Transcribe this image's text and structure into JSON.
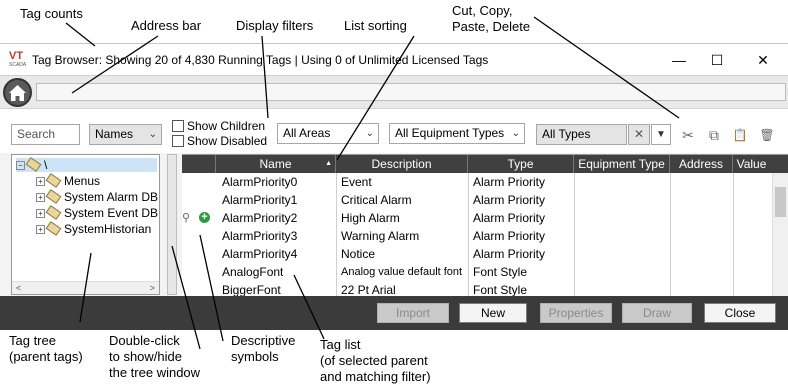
{
  "callouts": {
    "tag_counts": "Tag counts",
    "address_bar": "Address bar",
    "display_filters": "Display filters",
    "list_sorting": "List sorting",
    "cut_copy": "Cut, Copy,\nPaste, Delete",
    "tag_tree": "Tag tree\n(parent tags)",
    "double_click": "Double-click\nto show/hide\nthe tree window",
    "descriptive_symbols": "Descriptive\nsymbols",
    "tag_list": "Tag list\n(of selected parent\nand matching filter)"
  },
  "window": {
    "logo_text": "VT",
    "logo_sub": "SCADA",
    "title": "Tag Browser: Showing 20 of 4,830 Running Tags | Using 0 of Unlimited Licensed Tags",
    "minimize_glyph": "—",
    "maximize_glyph": "☐",
    "close_glyph": "✕"
  },
  "toolbar": {
    "search_placeholder": "Search",
    "search_value": "",
    "names_select": "Names",
    "show_children": "Show Children",
    "show_disabled": "Show Disabled",
    "areas_select": "All Areas",
    "equipment_select": "All Equipment Types",
    "types_select": "All Types",
    "clear_glyph": "✕",
    "filter_glyph": "▼",
    "cut_glyph": "✂",
    "copy_glyph": "⧉",
    "paste_glyph": "📋",
    "delete_glyph": "🗑"
  },
  "tree": {
    "root": "\\",
    "items": [
      "Menus",
      "System Alarm DB",
      "System Event DB",
      "SystemHistorian"
    ],
    "scroll_left": "<",
    "scroll_right": ">"
  },
  "grid": {
    "headers": {
      "name": "Name",
      "description": "Description",
      "type": "Type",
      "equipment_type": "Equipment Type",
      "address": "Address",
      "value": "Value"
    },
    "sort_arrow": "▲",
    "rows": [
      {
        "name": "AlarmPriority0",
        "description": "Event",
        "type": "Alarm Priority"
      },
      {
        "name": "AlarmPriority1",
        "description": "Critical Alarm",
        "type": "Alarm Priority"
      },
      {
        "name": "AlarmPriority2",
        "description": "High Alarm",
        "type": "Alarm Priority"
      },
      {
        "name": "AlarmPriority3",
        "description": "Warning Alarm",
        "type": "Alarm Priority"
      },
      {
        "name": "AlarmPriority4",
        "description": "Notice",
        "type": "Alarm Priority"
      },
      {
        "name": "AnalogFont",
        "description": "Analog value default font",
        "type": "Font Style"
      },
      {
        "name": "BiggerFont",
        "description": "22 Pt Arial",
        "type": "Font Style"
      }
    ],
    "symbols": {
      "tag_glyph": "⚲",
      "plus_glyph": "+"
    }
  },
  "buttons": {
    "import": "Import",
    "new": "New",
    "properties": "Properties",
    "draw": "Draw",
    "close": "Close"
  },
  "colors": {
    "header_bg": "#404040",
    "button_bar_bg": "#3b3b3b",
    "plus_symbol": "#2e9a3a"
  }
}
